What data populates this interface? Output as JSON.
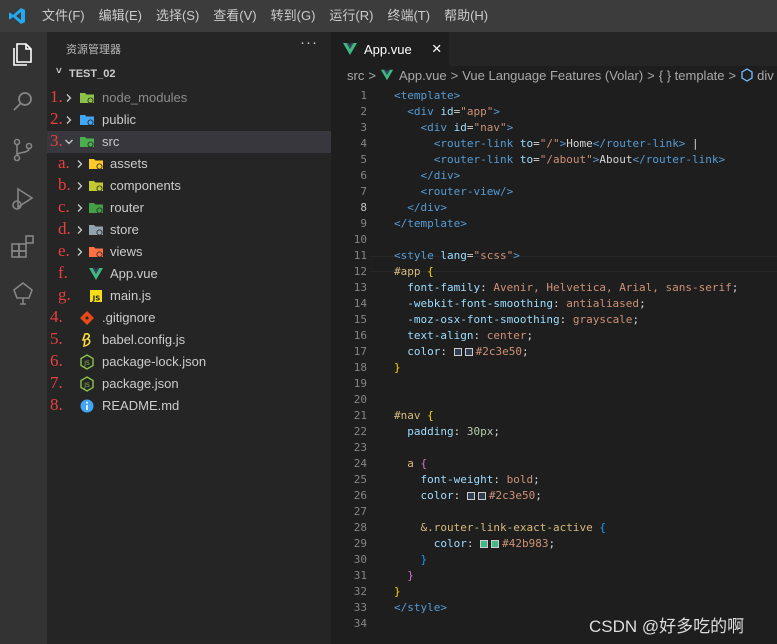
{
  "menubar": {
    "items": [
      "文件(F)",
      "编辑(E)",
      "选择(S)",
      "查看(V)",
      "转到(G)",
      "运行(R)",
      "终端(T)",
      "帮助(H)"
    ]
  },
  "activity_bar": {
    "icons": [
      "explorer-icon",
      "search-icon",
      "source-control-icon",
      "run-debug-icon",
      "extensions-icon",
      "remote-tree-icon"
    ]
  },
  "sidebar": {
    "title": "资源管理器",
    "more": "···",
    "project": "TEST_02",
    "tree": [
      {
        "num": "1.",
        "label": "node_modules",
        "kind": "folder",
        "icon": "folder-node-icon",
        "color": "#8bc34a",
        "dim": true
      },
      {
        "num": "2.",
        "label": "public",
        "kind": "folder",
        "icon": "folder-public-icon",
        "color": "#42a5f5"
      },
      {
        "num": "3.",
        "label": "src",
        "kind": "folder-open",
        "icon": "folder-src-icon",
        "color": "#4caf50",
        "selected": true
      },
      {
        "num": "a.",
        "label": "assets",
        "kind": "folder",
        "icon": "folder-assets-icon",
        "color": "#ffca28"
      },
      {
        "num": "b.",
        "label": "components",
        "kind": "folder",
        "icon": "folder-components-icon",
        "color": "#c0ca33"
      },
      {
        "num": "c.",
        "label": "router",
        "kind": "folder",
        "icon": "folder-router-icon",
        "color": "#43a047"
      },
      {
        "num": "d.",
        "label": "store",
        "kind": "folder",
        "icon": "folder-store-icon",
        "color": "#90a4ae"
      },
      {
        "num": "e.",
        "label": "views",
        "kind": "folder",
        "icon": "folder-views-icon",
        "color": "#ff7043"
      },
      {
        "num": "f.",
        "label": "App.vue",
        "kind": "file",
        "icon": "vue-file-icon",
        "color": "#41b883"
      },
      {
        "num": "g.",
        "label": "main.js",
        "kind": "file",
        "icon": "js-file-icon",
        "color": "#f5de19"
      },
      {
        "num": "4.",
        "label": ".gitignore",
        "kind": "file",
        "icon": "git-file-icon",
        "color": "#e64a19"
      },
      {
        "num": "5.",
        "label": "babel.config.js",
        "kind": "file",
        "icon": "babel-file-icon",
        "color": "#f9dc3e"
      },
      {
        "num": "6.",
        "label": "package-lock.json",
        "kind": "file",
        "icon": "npm-file-icon",
        "color": "#8bc34a"
      },
      {
        "num": "7.",
        "label": "package.json",
        "kind": "file",
        "icon": "npm-file-icon",
        "color": "#8bc34a"
      },
      {
        "num": "8.",
        "label": "README.md",
        "kind": "file",
        "icon": "info-file-icon",
        "color": "#42a5f5"
      }
    ]
  },
  "editor": {
    "tab": {
      "label": "App.vue",
      "close": "×"
    },
    "breadcrumbs": [
      "src",
      "App.vue",
      "Vue Language Features (Volar)",
      "{ } template",
      "div"
    ],
    "current_line": 8,
    "lines": [
      [
        [
          "<template>",
          "#569cd6"
        ]
      ],
      [
        [
          "  ",
          ""
        ],
        [
          "<div ",
          "#569cd6"
        ],
        [
          "id",
          "#9cdcfe"
        ],
        [
          "=",
          "#d4d4d4"
        ],
        [
          "\"app\"",
          "#ce9178"
        ],
        [
          ">",
          "#569cd6"
        ]
      ],
      [
        [
          "    ",
          ""
        ],
        [
          "<div ",
          "#569cd6"
        ],
        [
          "id",
          "#9cdcfe"
        ],
        [
          "=",
          "#d4d4d4"
        ],
        [
          "\"nav\"",
          "#ce9178"
        ],
        [
          ">",
          "#569cd6"
        ]
      ],
      [
        [
          "      ",
          ""
        ],
        [
          "<router-link ",
          "#569cd6"
        ],
        [
          "to",
          "#9cdcfe"
        ],
        [
          "=",
          "#d4d4d4"
        ],
        [
          "\"/\"",
          "#ce9178"
        ],
        [
          ">",
          "#569cd6"
        ],
        [
          "Home",
          "#d4d4d4"
        ],
        [
          "</router-link>",
          "#569cd6"
        ],
        [
          " |",
          "#d4d4d4"
        ]
      ],
      [
        [
          "      ",
          ""
        ],
        [
          "<router-link ",
          "#569cd6"
        ],
        [
          "to",
          "#9cdcfe"
        ],
        [
          "=",
          "#d4d4d4"
        ],
        [
          "\"/about\"",
          "#ce9178"
        ],
        [
          ">",
          "#569cd6"
        ],
        [
          "About",
          "#d4d4d4"
        ],
        [
          "</router-link>",
          "#569cd6"
        ]
      ],
      [
        [
          "    ",
          ""
        ],
        [
          "</div>",
          "#569cd6"
        ]
      ],
      [
        [
          "    ",
          ""
        ],
        [
          "<router-view/>",
          "#569cd6"
        ]
      ],
      [
        [
          "  ",
          ""
        ],
        [
          "</div>",
          "#569cd6"
        ]
      ],
      [
        [
          "</template>",
          "#569cd6"
        ]
      ],
      [],
      [
        [
          "<style ",
          "#569cd6"
        ],
        [
          "lang",
          "#9cdcfe"
        ],
        [
          "=",
          "#d4d4d4"
        ],
        [
          "\"scss\"",
          "#ce9178"
        ],
        [
          ">",
          "#569cd6"
        ]
      ],
      [
        [
          "#app ",
          "#d7ba7d"
        ],
        [
          "{",
          "#ffd700"
        ]
      ],
      [
        [
          "  ",
          ""
        ],
        [
          "font-family",
          "#9cdcfe"
        ],
        [
          ": ",
          "#d4d4d4"
        ],
        [
          "Avenir, Helvetica, Arial, sans-serif",
          "#ce9178"
        ],
        [
          ";",
          "#d4d4d4"
        ]
      ],
      [
        [
          "  ",
          ""
        ],
        [
          "-webkit-font-smoothing",
          "#9cdcfe"
        ],
        [
          ": ",
          "#d4d4d4"
        ],
        [
          "antialiased",
          "#ce9178"
        ],
        [
          ";",
          "#d4d4d4"
        ]
      ],
      [
        [
          "  ",
          ""
        ],
        [
          "-moz-osx-font-smoothing",
          "#9cdcfe"
        ],
        [
          ": ",
          "#d4d4d4"
        ],
        [
          "grayscale",
          "#ce9178"
        ],
        [
          ";",
          "#d4d4d4"
        ]
      ],
      [
        [
          "  ",
          ""
        ],
        [
          "text-align",
          "#9cdcfe"
        ],
        [
          ": ",
          "#d4d4d4"
        ],
        [
          "center",
          "#ce9178"
        ],
        [
          ";",
          "#d4d4d4"
        ]
      ],
      [
        [
          "  ",
          ""
        ],
        [
          "color",
          "#9cdcfe"
        ],
        [
          ": ",
          "#d4d4d4"
        ],
        [
          "@#2c3e50",
          "#ce9178"
        ],
        [
          ";",
          "#d4d4d4"
        ]
      ],
      [
        [
          "}",
          "#ffd700"
        ]
      ],
      [],
      [],
      [
        [
          "#nav ",
          "#d7ba7d"
        ],
        [
          "{",
          "#ffd700"
        ]
      ],
      [
        [
          "  ",
          ""
        ],
        [
          "padding",
          "#9cdcfe"
        ],
        [
          ": ",
          "#d4d4d4"
        ],
        [
          "30px",
          "#b5cea8"
        ],
        [
          ";",
          "#d4d4d4"
        ]
      ],
      [],
      [
        [
          "  ",
          ""
        ],
        [
          "a ",
          "#d7ba7d"
        ],
        [
          "{",
          "#da70d6"
        ]
      ],
      [
        [
          "    ",
          ""
        ],
        [
          "font-weight",
          "#9cdcfe"
        ],
        [
          ": ",
          "#d4d4d4"
        ],
        [
          "bold",
          "#ce9178"
        ],
        [
          ";",
          "#d4d4d4"
        ]
      ],
      [
        [
          "    ",
          ""
        ],
        [
          "color",
          "#9cdcfe"
        ],
        [
          ": ",
          "#d4d4d4"
        ],
        [
          "@#2c3e50",
          "#ce9178"
        ],
        [
          ";",
          "#d4d4d4"
        ]
      ],
      [],
      [
        [
          "    ",
          ""
        ],
        [
          "&.router-link-exact-active ",
          "#d7ba7d"
        ],
        [
          "{",
          "#179fff"
        ]
      ],
      [
        [
          "      ",
          ""
        ],
        [
          "color",
          "#9cdcfe"
        ],
        [
          ": ",
          "#d4d4d4"
        ],
        [
          "@#42b983",
          "#ce9178"
        ],
        [
          ";",
          "#d4d4d4"
        ]
      ],
      [
        [
          "    ",
          ""
        ],
        [
          "}",
          "#179fff"
        ]
      ],
      [
        [
          "  ",
          ""
        ],
        [
          "}",
          "#da70d6"
        ]
      ],
      [
        [
          "}",
          "#ffd700"
        ]
      ],
      [
        [
          "</style>",
          "#569cd6"
        ]
      ],
      []
    ]
  },
  "watermark": "CSDN @好多吃的啊"
}
